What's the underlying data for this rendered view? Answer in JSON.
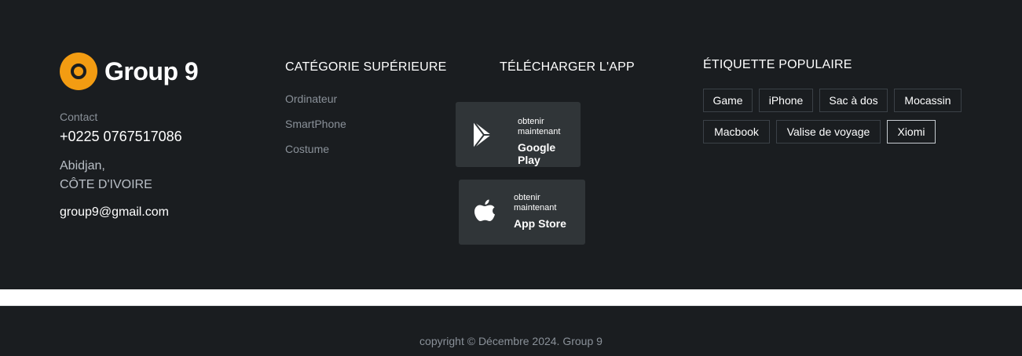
{
  "brand": {
    "name": "Group 9",
    "accent": "#f39c12",
    "icon": "ring-logo-icon"
  },
  "contact": {
    "label": "Contact",
    "phone": "+0225 0767517086",
    "city": "Abidjan,",
    "country": "CÔTE D'IVOIRE",
    "email": "group9@gmail.com"
  },
  "categories": {
    "title": "CATÉGORIE SUPÉRIEURE",
    "items": [
      "Ordinateur",
      "SmartPhone",
      "Costume"
    ]
  },
  "app": {
    "title": "TÉLÉCHARGER L'APP",
    "google_play": {
      "small": "obtenir maintenant",
      "big": "Google Play",
      "icon": "google-play-icon"
    },
    "app_store": {
      "small": "obtenir maintenant",
      "big": "App Store",
      "icon": "apple-icon"
    }
  },
  "tags": {
    "title": "ÉTIQUETTE POPULAIRE",
    "items": [
      "Game",
      "iPhone",
      "Sac à dos",
      "Mocassin",
      "Macbook",
      "Valise de voyage",
      "Xiomi"
    ],
    "active": "Xiomi"
  },
  "footer": {
    "copyright": "copyright © Décembre 2024. Group 9"
  },
  "colors": {
    "background": "#1a1d20",
    "button_bg": "#303538",
    "muted_text": "#8a9199"
  }
}
